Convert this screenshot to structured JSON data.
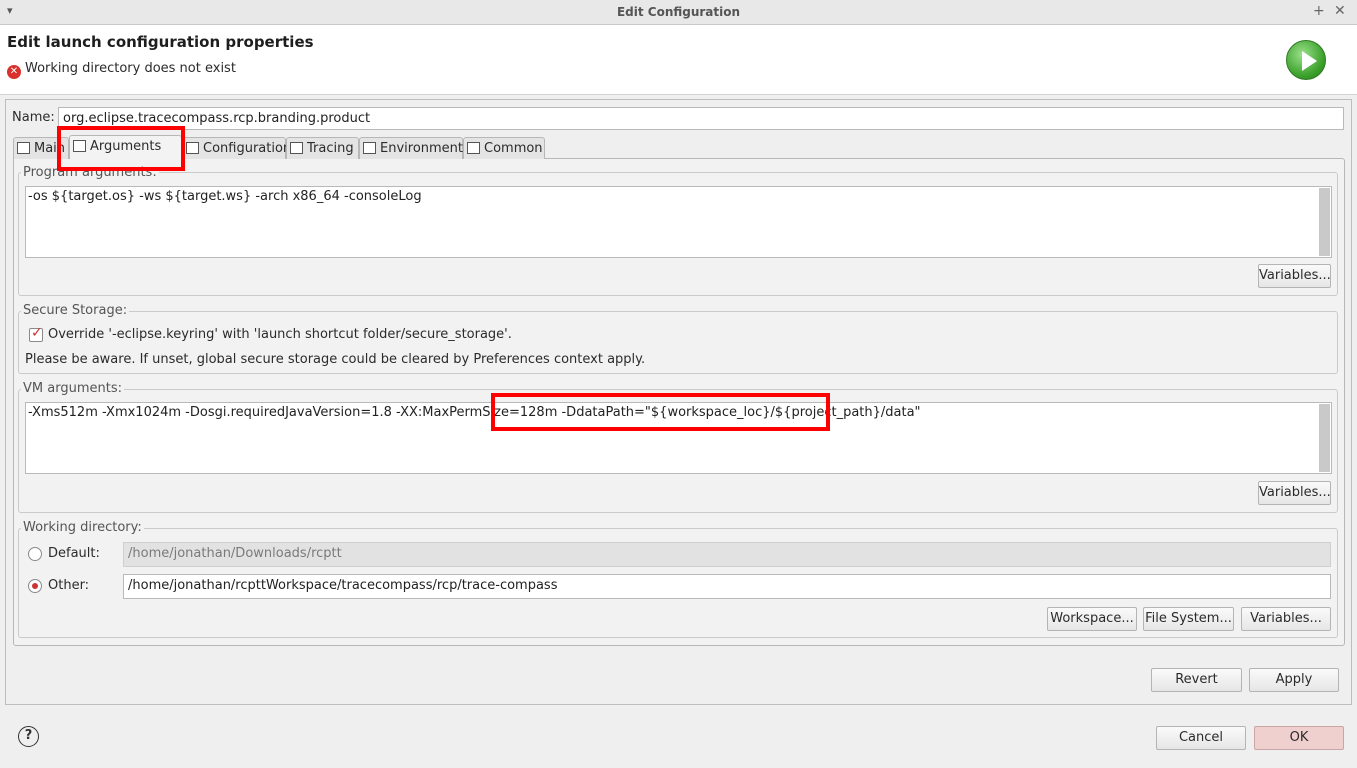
{
  "window": {
    "title": "Edit Configuration",
    "menu_glyph": "▾",
    "max_glyph": "+",
    "close_glyph": "✕"
  },
  "header": {
    "heading": "Edit launch configuration properties",
    "error_message": "Working directory does not exist",
    "error_icon": "error-circle-icon",
    "run_icon": "run-launch-icon"
  },
  "name": {
    "label": "Name:",
    "value": "org.eclipse.tracecompass.rcp.branding.product"
  },
  "tabs": [
    {
      "label": "Main",
      "icon": "main-tab-icon"
    },
    {
      "label": "Arguments",
      "icon": "arguments-tab-icon",
      "active": true
    },
    {
      "label": "Configuration",
      "icon": "configuration-tab-icon"
    },
    {
      "label": "Tracing",
      "icon": "tracing-tab-icon"
    },
    {
      "label": "Environment",
      "icon": "environment-tab-icon"
    },
    {
      "label": "Common",
      "icon": "common-tab-icon"
    }
  ],
  "program_args": {
    "title": "Program arguments:",
    "value": "-os ${target.os} -ws ${target.ws} -arch x86_64 -consoleLog",
    "variables_button": "Variables..."
  },
  "secure_storage": {
    "title": "Secure Storage:",
    "checkbox_label": "Override '-eclipse.keyring' with 'launch shortcut folder/secure_storage'.",
    "checked": true,
    "note": "Please be aware. If unset, global secure storage could be cleared by Preferences context apply."
  },
  "vm_args": {
    "title": "VM arguments:",
    "value_part1": "-Xms512m -Xmx1024m -Dosgi.requiredJavaVersion=1.8 -XX:MaxPermSize=128m",
    "value_part2": " -DdataPath=\"${workspace_loc}/${project_path}/data\"",
    "variables_button": "Variables..."
  },
  "working_dir": {
    "title": "Working directory:",
    "default_label": "Default:",
    "default_value": "/home/jonathan/Downloads/rcptt",
    "other_label": "Other:",
    "other_value": "/home/jonathan/rcpttWorkspace/tracecompass/rcp/trace-compass",
    "selected": "Other",
    "workspace_button": "Workspace...",
    "filesystem_button": "File System...",
    "variables_button": "Variables..."
  },
  "actions": {
    "revert": "Revert",
    "apply": "Apply"
  },
  "footer": {
    "help_glyph": "?",
    "cancel": "Cancel",
    "ok": "OK"
  }
}
